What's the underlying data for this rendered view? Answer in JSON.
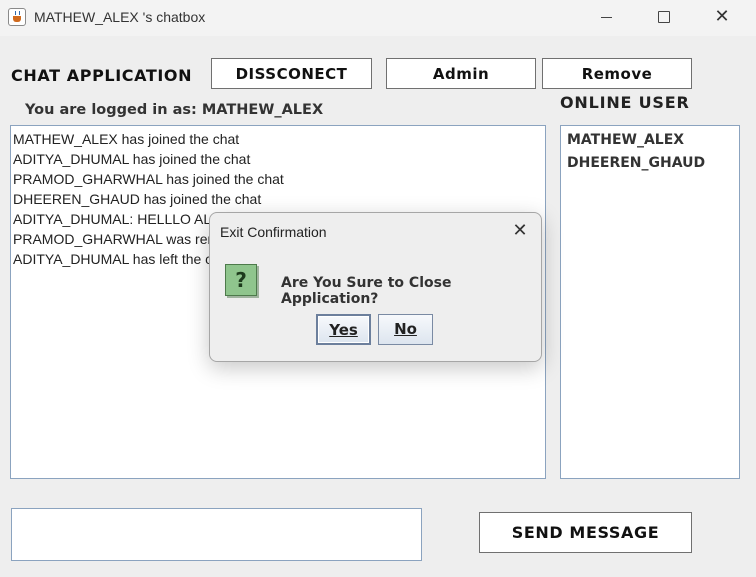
{
  "window": {
    "title": "MATHEW_ALEX 's chatbox",
    "minimize_glyph": "—",
    "maximize_glyph": "☐",
    "close_glyph": "✕"
  },
  "header": {
    "app_heading": "CHAT APPLICATION",
    "disconnect_label": "DISSCONECT",
    "admin_label": "Admin",
    "remove_label": "Remove"
  },
  "session": {
    "logged_in_text": "You are logged in as: MATHEW_ALEX"
  },
  "chat": {
    "messages": [
      "MATHEW_ALEX has joined the chat",
      "ADITYA_DHUMAL has joined the chat",
      "PRAMOD_GHARWHAL has joined the chat",
      "DHEEREN_GHAUD has joined the chat",
      "ADITYA_DHUMAL: HELLLO ALL HOW ARE YOU ??",
      "PRAMOD_GHARWHAL was removed from the chat",
      "ADITYA_DHUMAL has left the chat"
    ]
  },
  "online": {
    "title": "ONLINE USER",
    "users": [
      "MATHEW_ALEX",
      "DHEEREN_GHAUD"
    ]
  },
  "composer": {
    "message_value": "",
    "send_label": "SEND MESSAGE"
  },
  "dialog": {
    "title": "Exit Confirmation",
    "close_glyph": "✕",
    "icon": "question-icon",
    "icon_glyph": "?",
    "message": "Are You Sure to Close Application?",
    "yes_label": "Yes",
    "no_label": "No"
  },
  "colors": {
    "window_bg": "#eeeeee",
    "field_border": "#8ba3bf",
    "question_icon_bg": "#8fc58d"
  }
}
